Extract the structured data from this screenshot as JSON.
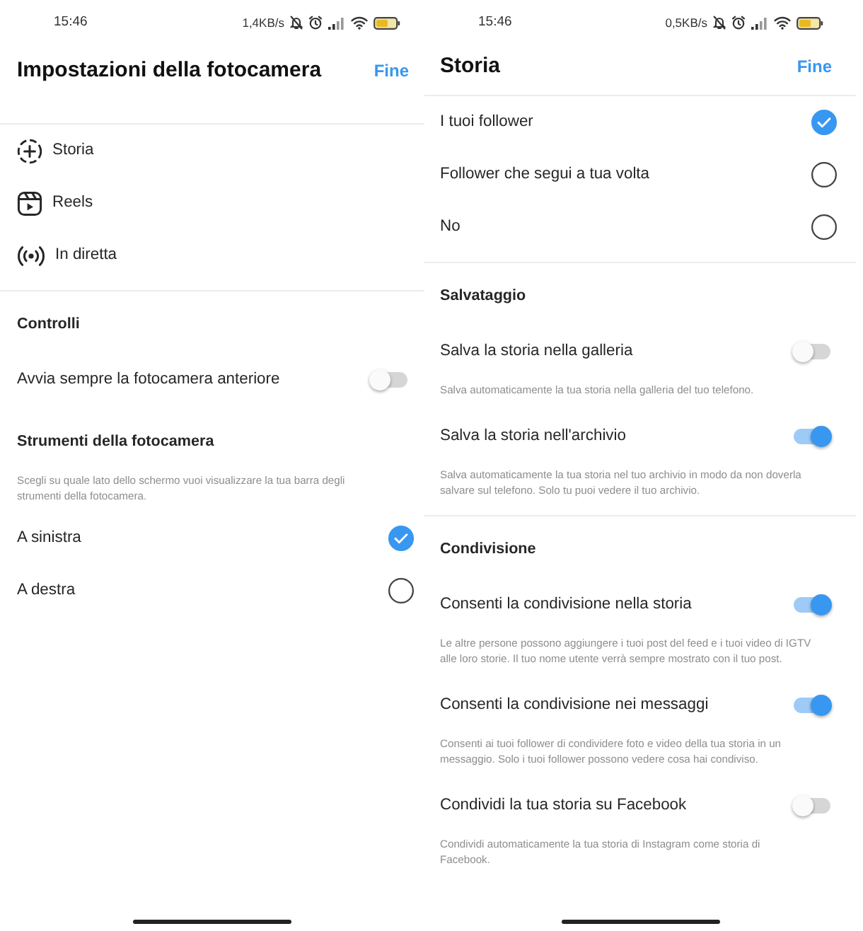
{
  "screens": [
    {
      "status_bar": {
        "time": "15:46",
        "network_speed": "1,4KB/s"
      },
      "header": {
        "title": "Impostazioni della fotocamera",
        "action": "Fine"
      },
      "sections": [
        {
          "items": [
            {
              "kind": "link",
              "label": "Storia"
            },
            {
              "kind": "link",
              "label": "Reels"
            },
            {
              "kind": "link",
              "label": "In diretta"
            }
          ]
        },
        {
          "items": [
            {
              "kind": "heading",
              "label": "Controlli"
            },
            {
              "kind": "toggle",
              "label": "Avvia sempre la fotocamera anteriore",
              "on": false
            },
            {
              "kind": "heading",
              "label": "Strumenti della fotocamera"
            },
            {
              "kind": "note",
              "text": "Scegli su quale lato dello schermo vuoi visualizzare la tua barra degli strumenti della fotocamera."
            },
            {
              "kind": "radio",
              "label": "A sinistra",
              "selected": true
            },
            {
              "kind": "radio",
              "label": "A destra",
              "selected": false
            }
          ]
        }
      ]
    },
    {
      "status_bar": {
        "time": "15:46",
        "network_speed": "0,5KB/s"
      },
      "header": {
        "title": "Storia",
        "action": "Fine"
      },
      "sections": [
        {
          "items": [
            {
              "kind": "radio",
              "label": "I tuoi follower",
              "selected": true
            },
            {
              "kind": "radio",
              "label": "Follower che segui a tua volta",
              "selected": false
            },
            {
              "kind": "radio",
              "label": "No",
              "selected": false
            }
          ]
        },
        {
          "items": [
            {
              "kind": "heading",
              "label": "Salvataggio"
            },
            {
              "kind": "toggle",
              "label": "Salva la storia nella galleria",
              "on": false
            },
            {
              "kind": "note",
              "text": "Salva automaticamente la tua storia nella galleria del tuo telefono."
            },
            {
              "kind": "toggle",
              "label": "Salva la storia nell'archivio",
              "on": true
            },
            {
              "kind": "note",
              "text": "Salva automaticamente la tua storia nel tuo archivio in modo da non doverla salvare sul telefono. Solo tu puoi vedere il tuo archivio."
            }
          ]
        },
        {
          "items": [
            {
              "kind": "heading",
              "label": "Condivisione"
            },
            {
              "kind": "toggle",
              "label": "Consenti la condivisione nella storia",
              "on": true
            },
            {
              "kind": "note",
              "text": "Le altre persone possono aggiungere i tuoi post del feed e i tuoi video di IGTV alle loro storie. Il tuo nome utente verrà sempre mostrato con il tuo post."
            },
            {
              "kind": "toggle",
              "label": "Consenti la condivisione nei messaggi",
              "on": true
            },
            {
              "kind": "note",
              "text": "Consenti ai tuoi follower di condividere foto e video della tua storia in un messaggio. Solo i tuoi follower possono vedere cosa hai condiviso."
            },
            {
              "kind": "toggle",
              "label": "Condividi la tua storia su Facebook",
              "on": false
            },
            {
              "kind": "note",
              "text": "Condividi automaticamente la tua storia di Instagram come storia di Facebook."
            }
          ]
        }
      ]
    }
  ]
}
